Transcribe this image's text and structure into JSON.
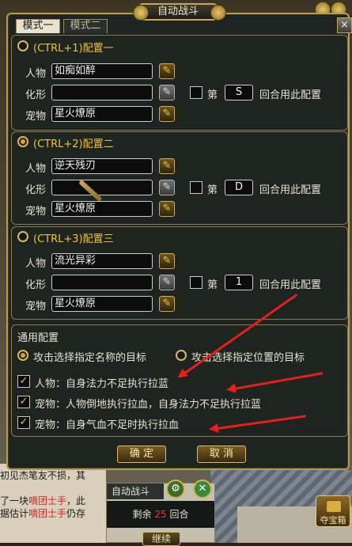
{
  "title": "自动战斗",
  "close_label": "×",
  "tabs": [
    {
      "label": "模式一",
      "active": true
    },
    {
      "label": "模式二",
      "active": false
    }
  ],
  "configs": [
    {
      "title": "(CTRL+1)配置一",
      "selected": false,
      "pet_label": "人物",
      "pet_value": "如痴如醉",
      "form_label": "化形",
      "form_value": "",
      "pet2_label": "宠物",
      "pet2_value": "星火燎原",
      "round_checked": false,
      "round_prefix": "第",
      "round_value": "S",
      "round_suffix": "回合用此配置"
    },
    {
      "title": "(CTRL+2)配置二",
      "selected": true,
      "pet_label": "人物",
      "pet_value": "逆天残刃",
      "form_label": "化形",
      "form_value": "",
      "pet2_label": "宠物",
      "pet2_value": "星火燎原",
      "round_checked": false,
      "round_prefix": "第",
      "round_value": "D",
      "round_suffix": "回合用此配置"
    },
    {
      "title": "(CTRL+3)配置三",
      "selected": false,
      "pet_label": "人物",
      "pet_value": "流光异彩",
      "form_label": "化形",
      "form_value": "",
      "pet2_label": "宠物",
      "pet2_value": "星火燎原",
      "round_checked": false,
      "round_prefix": "第",
      "round_value": "1",
      "round_suffix": "回合用此配置"
    }
  ],
  "general": {
    "title": "通用配置",
    "target_by_name": "攻击选择指定名称的目标",
    "target_by_name_selected": true,
    "target_by_pos": "攻击选择指定位置的目标",
    "target_by_pos_selected": false,
    "options": [
      {
        "label": "人物：自身法力不足执行拉蓝",
        "checked": true
      },
      {
        "label": "宠物：人物倒地执行拉血，自身法力不足执行拉蓝",
        "checked": true
      },
      {
        "label": "宠物：自身气血不足时执行拉血",
        "checked": true
      }
    ]
  },
  "confirm_label": "确 定",
  "cancel_label": "取 消",
  "auto_widget": {
    "title": "自动战斗",
    "remain_prefix": "剩余",
    "remain_num": "25",
    "remain_suffix": "回合",
    "continue_label": "继续"
  },
  "treasure_label": "夺宝箱",
  "background_text": [
    {
      "pre": "初见杰笔友不损，其",
      "red": "",
      "post": ""
    },
    {
      "pre": "了一块",
      "red": "嘀团士手",
      "post": "，此"
    },
    {
      "pre": "据估计",
      "red": "嘀团士手",
      "post": "仍存"
    }
  ],
  "colors": {
    "accent": "#f0c23a",
    "arrow": "#e5201a",
    "frame": "#b89a4e"
  },
  "icons": {
    "edit": "pencil-icon",
    "check": "checkmark-icon",
    "settings": "gear-icon"
  }
}
